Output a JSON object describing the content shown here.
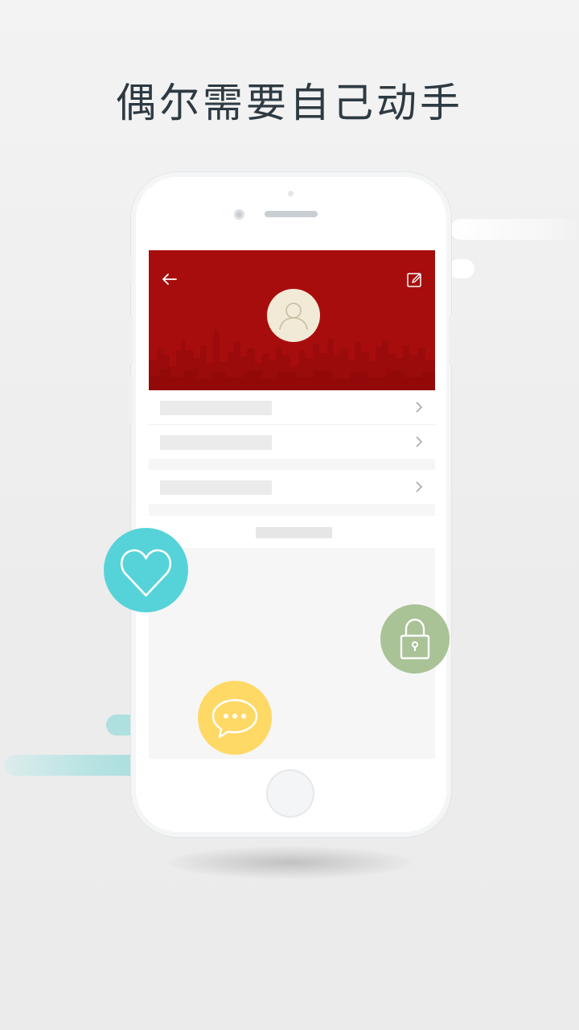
{
  "headline": "偶尔需要自己动手",
  "colors": {
    "header_red": "#a80d0d",
    "avatar_bg": "#f1ead7",
    "heart_teal": "#56d3d9",
    "lock_green": "#a9c296",
    "chat_yellow": "#ffd966",
    "headline_text": "#2e3a42"
  },
  "profile_screen": {
    "header": {
      "back_icon": "arrow-left-icon",
      "edit_icon": "edit-pencil-icon",
      "avatar_icon": "user-outline-icon"
    },
    "menu_groups": [
      {
        "rows": 2,
        "row_icon": "chevron-right-icon"
      },
      {
        "rows": 1,
        "row_icon": "chevron-right-icon"
      }
    ]
  },
  "feature_badges": [
    {
      "name": "heart",
      "icon": "heart-icon"
    },
    {
      "name": "lock",
      "icon": "lock-icon"
    },
    {
      "name": "chat",
      "icon": "chat-bubble-icon"
    }
  ]
}
